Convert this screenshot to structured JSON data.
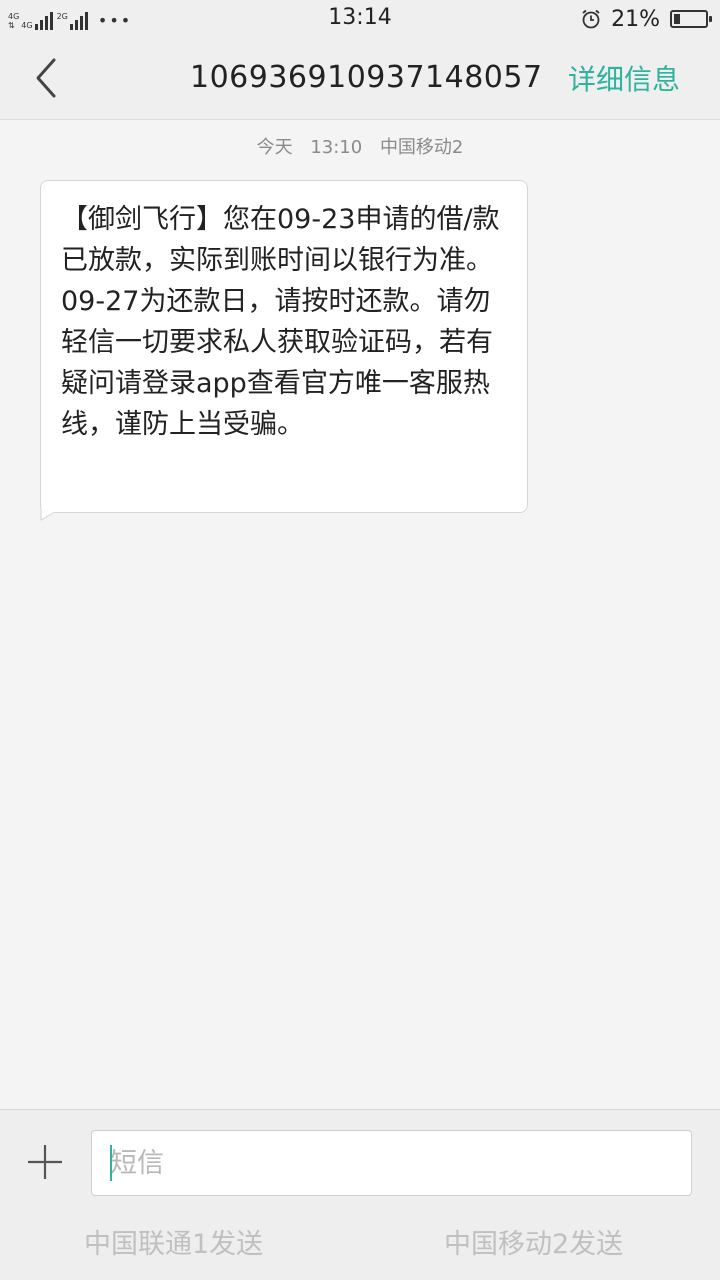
{
  "status_bar": {
    "sim1_network": "4G",
    "sim2_network_top": "4G",
    "sim2_network": "2G",
    "more_indicator": "•••",
    "time": "13:14",
    "alarm_icon": "alarm-clock-icon",
    "battery_percent": "21%",
    "battery_level": 0.21
  },
  "header": {
    "back_icon": "chevron-left-icon",
    "title": "106936910937148057",
    "details_label": "详细信息"
  },
  "conversation": {
    "messages": [
      {
        "day": "今天",
        "time": "13:10",
        "carrier": "中国移动2",
        "text": "【御剑飞行】您在09-23申请的借/款已放款，实际到账时间以银行为准。09-27为还款日，请按时还款。请勿轻信一切要求私人获取验证码，若有疑问请登录app查看官方唯一客服热线，谨防上当受骗。"
      }
    ]
  },
  "compose": {
    "attach_icon": "plus-icon",
    "placeholder": "短信",
    "value": "",
    "send_sim1_label": "中国联通1发送",
    "send_sim2_label": "中国移动2发送"
  },
  "colors": {
    "accent": "#2fb39d",
    "background": "#f4f4f4",
    "bar_background": "#efefef"
  }
}
